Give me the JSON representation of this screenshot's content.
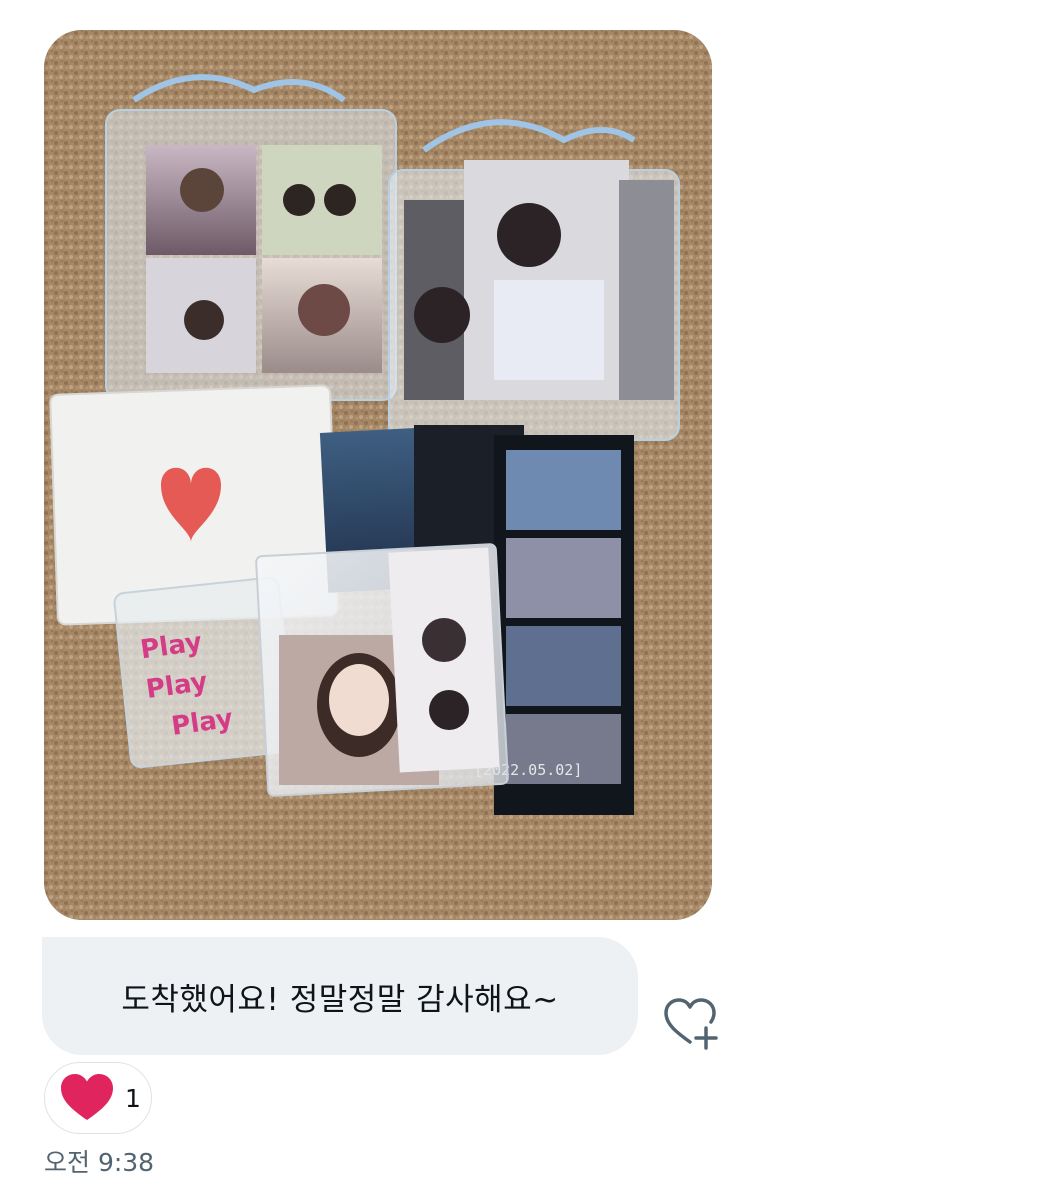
{
  "message": {
    "attachment": {
      "photocard_stamp": "[2022.05.02]",
      "bag_print": "Play Play Play"
    },
    "text": "도착했어요! 정말정말 감사해요~",
    "reaction": {
      "icon": "heart-icon",
      "color": "#e0245e",
      "count": "1"
    },
    "add_reaction_icon": "heart-plus-icon",
    "timestamp": "오전 9:38"
  }
}
